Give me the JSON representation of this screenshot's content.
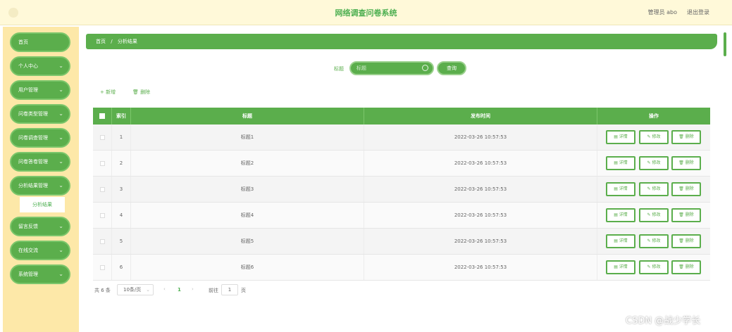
{
  "header": {
    "title": "网络调查问卷系统",
    "user": "管理员 abo",
    "logout": "退出登录"
  },
  "sidebar": {
    "items": [
      {
        "label": "首页",
        "chevron": false
      },
      {
        "label": "个人中心",
        "chevron": true
      },
      {
        "label": "用户管理",
        "chevron": true
      },
      {
        "label": "问卷类型管理",
        "chevron": true
      },
      {
        "label": "问卷调查管理",
        "chevron": true
      },
      {
        "label": "问卷答卷管理",
        "chevron": true
      },
      {
        "label": "分析结果管理",
        "chevron": true
      },
      {
        "label": "留言反馈",
        "chevron": true
      },
      {
        "label": "在线交流",
        "chevron": true
      },
      {
        "label": "系统管理",
        "chevron": true
      }
    ],
    "submenu": "分析结果"
  },
  "breadcrumb": {
    "home": "首页",
    "separator": "/",
    "current": "分析结果"
  },
  "search": {
    "label": "标题",
    "placeholder": "标题",
    "button": "查询"
  },
  "toolbar": {
    "add": "+ 新增",
    "delete": "删除"
  },
  "table": {
    "columns": [
      "",
      "索引",
      "标题",
      "发布时间",
      "操作"
    ],
    "rows": [
      {
        "index": "1",
        "title": "标题1",
        "time": "2022-03-26 10:57:53"
      },
      {
        "index": "2",
        "title": "标题2",
        "time": "2022-03-26 10:57:53"
      },
      {
        "index": "3",
        "title": "标题3",
        "time": "2022-03-26 10:57:53"
      },
      {
        "index": "4",
        "title": "标题4",
        "time": "2022-03-26 10:57:53"
      },
      {
        "index": "5",
        "title": "标题5",
        "time": "2022-03-26 10:57:53"
      },
      {
        "index": "6",
        "title": "标题6",
        "time": "2022-03-26 10:57:53"
      }
    ],
    "actions": {
      "detail": "详情",
      "edit": "修改",
      "delete": "删除"
    }
  },
  "pagination": {
    "total": "共 6 条",
    "page_size": "10条/页",
    "current_page": "1",
    "goto_label": "前往",
    "goto_value": "1",
    "page_suffix": "页"
  },
  "watermark": "CSDN @战少学长",
  "colors": {
    "primary": "#5bae4c",
    "sidebar_bg": "#fde8a8",
    "header_bg": "#fff9d9"
  }
}
